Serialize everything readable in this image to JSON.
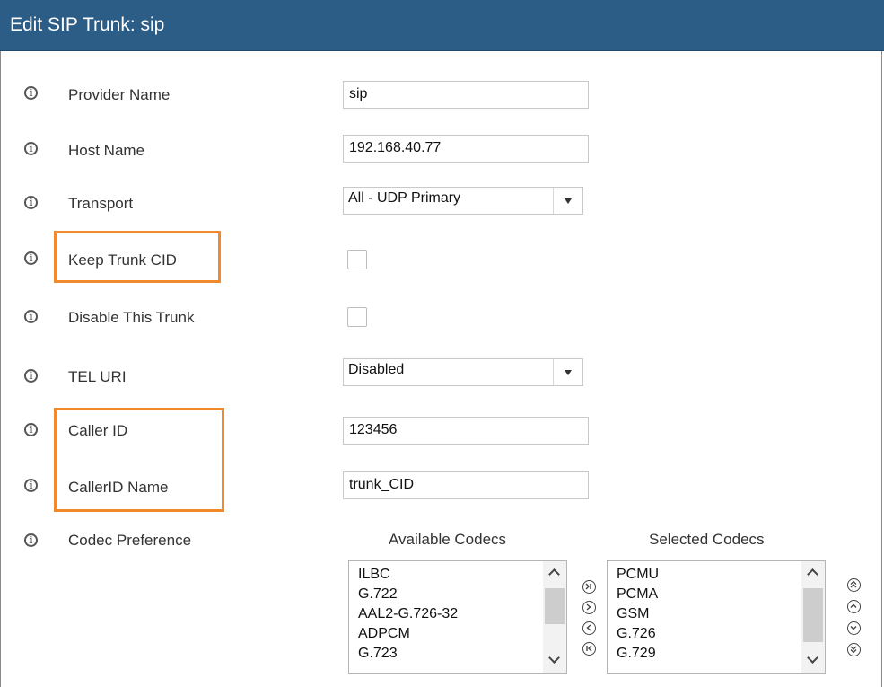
{
  "window": {
    "title": "Edit SIP Trunk: sip"
  },
  "form": {
    "provider_name": {
      "label": "Provider Name",
      "value": "sip"
    },
    "host_name": {
      "label": "Host Name",
      "value": "192.168.40.77"
    },
    "transport": {
      "label": "Transport",
      "value": "All - UDP Primary"
    },
    "keep_trunk_cid": {
      "label": "Keep Trunk CID",
      "checked": false
    },
    "disable_trunk": {
      "label": "Disable This Trunk",
      "checked": false
    },
    "tel_uri": {
      "label": "TEL URI",
      "value": "Disabled"
    },
    "caller_id": {
      "label": "Caller ID",
      "value": "123456"
    },
    "caller_id_name": {
      "label": "CallerID Name",
      "value": "trunk_CID"
    },
    "codec_preference": {
      "label": "Codec Preference"
    }
  },
  "codecs": {
    "available_label": "Available Codecs",
    "selected_label": "Selected Codecs",
    "available": [
      "ILBC",
      "G.722",
      "AAL2-G.726-32",
      "ADPCM",
      "G.723"
    ],
    "selected": [
      "PCMU",
      "PCMA",
      "GSM",
      "G.726",
      "G.729"
    ]
  },
  "colors": {
    "header_bg": "#2c5d86",
    "highlight": "#f08a2c"
  },
  "icons": {
    "info": "info-circle-icon",
    "move_all_right": "move-all-right-icon",
    "move_right": "move-right-icon",
    "move_left": "move-left-icon",
    "move_all_left": "move-all-left-icon",
    "move_top": "move-top-icon",
    "move_up": "move-up-icon",
    "move_down": "move-down-icon",
    "move_bottom": "move-bottom-icon"
  }
}
